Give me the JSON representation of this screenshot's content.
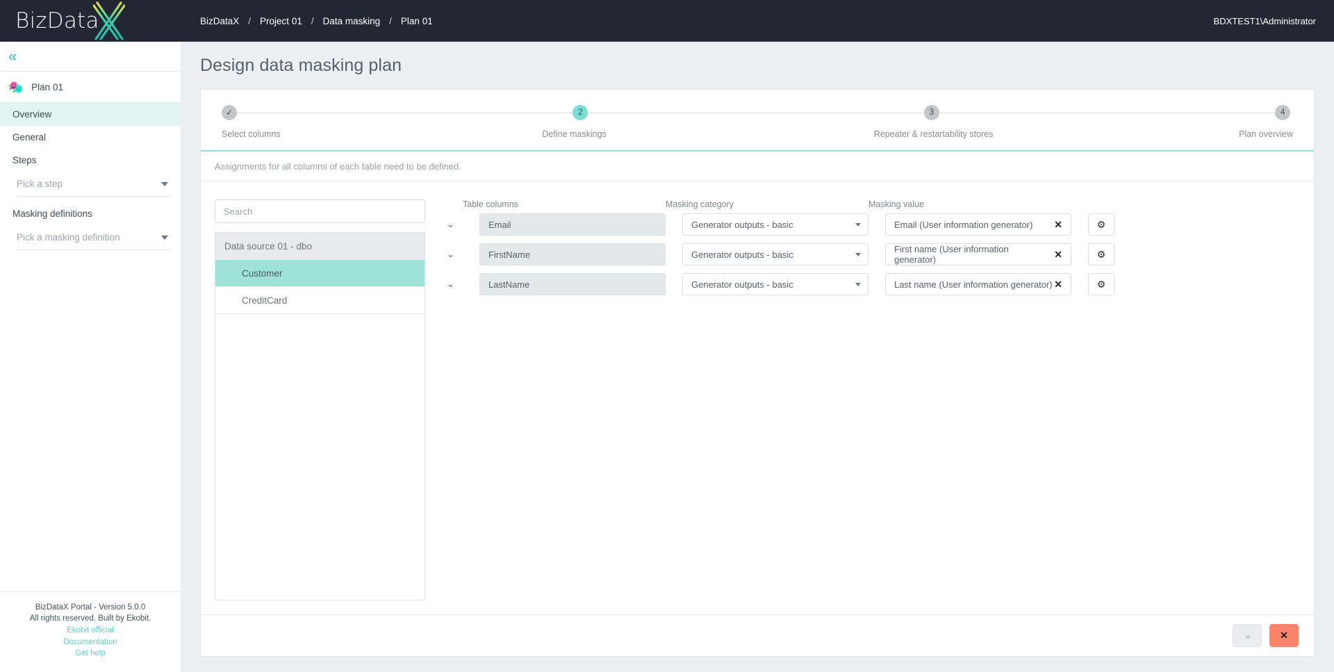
{
  "brand": {
    "name_prefix": "BizData",
    "name_suffix": "X",
    "accent": "#2bbbad",
    "accent_light": "#7adfd3",
    "dark": "#232733",
    "danger": "#fc8469"
  },
  "sidebar": {
    "collapse_icon": "«",
    "plan": {
      "icon": "🎭",
      "label": "Plan 01"
    },
    "items": [
      {
        "label": "Overview",
        "active": true
      },
      {
        "label": "General",
        "active": false
      }
    ],
    "groups": [
      {
        "label": "Steps",
        "picker_placeholder": "Pick a step"
      },
      {
        "label": "Masking definitions",
        "picker_placeholder": "Pick a masking definition"
      }
    ],
    "footer": {
      "version": "BizDataX Portal - Version 5.0.0",
      "rights": "All rights reserved. Built by Ekobit.",
      "links": [
        "Ekobit official",
        "Documentation",
        "Get help"
      ]
    }
  },
  "topbar": {
    "breadcrumbs": [
      "BizDataX",
      "Project 01",
      "Data masking",
      "Plan 01"
    ],
    "separator": "/",
    "user": "BDXTEST1\\Administrator"
  },
  "page": {
    "title": "Design data masking plan",
    "notice": "Assignments for all columns of each table need to be defined."
  },
  "stepper": {
    "steps": [
      {
        "marker": "✓",
        "label": "Select columns",
        "state": "done"
      },
      {
        "marker": "2",
        "label": "Define maskings",
        "state": "current"
      },
      {
        "marker": "3",
        "label": "Repeater & restartability stores",
        "state": "upcoming"
      },
      {
        "marker": "4",
        "label": "Plan overview",
        "state": "upcoming"
      }
    ]
  },
  "tree": {
    "search_placeholder": "Search",
    "nodes": [
      {
        "label": "Data source 01 - dbo",
        "type": "group",
        "selected": false
      },
      {
        "label": "Customer",
        "type": "child",
        "selected": true
      },
      {
        "label": "CreditCard",
        "type": "child",
        "selected": false
      }
    ]
  },
  "maskings": {
    "headers": {
      "table_columns": "Table columns",
      "masking_category": "Masking category",
      "masking_value": "Masking value"
    },
    "clear_icon": "✕",
    "gear_icon": "⚙",
    "expand_icon": "⌄",
    "rows": [
      {
        "column": "Email",
        "category": "Generator outputs - basic",
        "value": "Email (User information generator)"
      },
      {
        "column": "FirstName",
        "category": "Generator outputs - basic",
        "value": "First name (User information generator)"
      },
      {
        "column": "LastName",
        "category": "Generator outputs - basic",
        "value": "Last name (User information generator)"
      }
    ]
  },
  "actions": {
    "next_label": "»",
    "close_label": "✕"
  }
}
